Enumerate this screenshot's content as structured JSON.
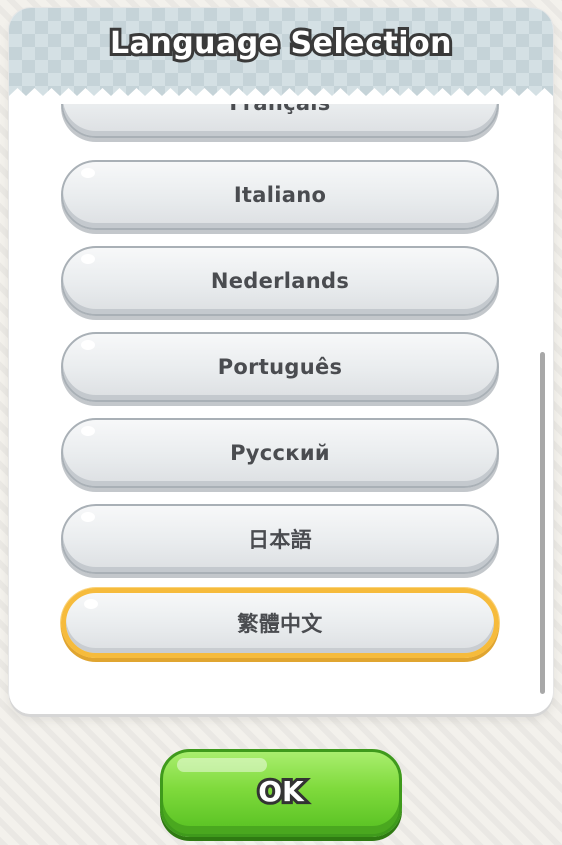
{
  "dialog": {
    "title": "Language Selection"
  },
  "languages": [
    {
      "label": "Français",
      "selected": false
    },
    {
      "label": "Italiano",
      "selected": false
    },
    {
      "label": "Nederlands",
      "selected": false
    },
    {
      "label": "Português",
      "selected": false
    },
    {
      "label": "Русский",
      "selected": false
    },
    {
      "label": "日本語",
      "selected": false
    },
    {
      "label": "繁體中文",
      "selected": true
    }
  ],
  "ok_button": {
    "label": "OK"
  },
  "colors": {
    "selected_border": "#f6bb3c",
    "ok_green": "#7fda3c",
    "header_bg": "#d4e0e4"
  }
}
